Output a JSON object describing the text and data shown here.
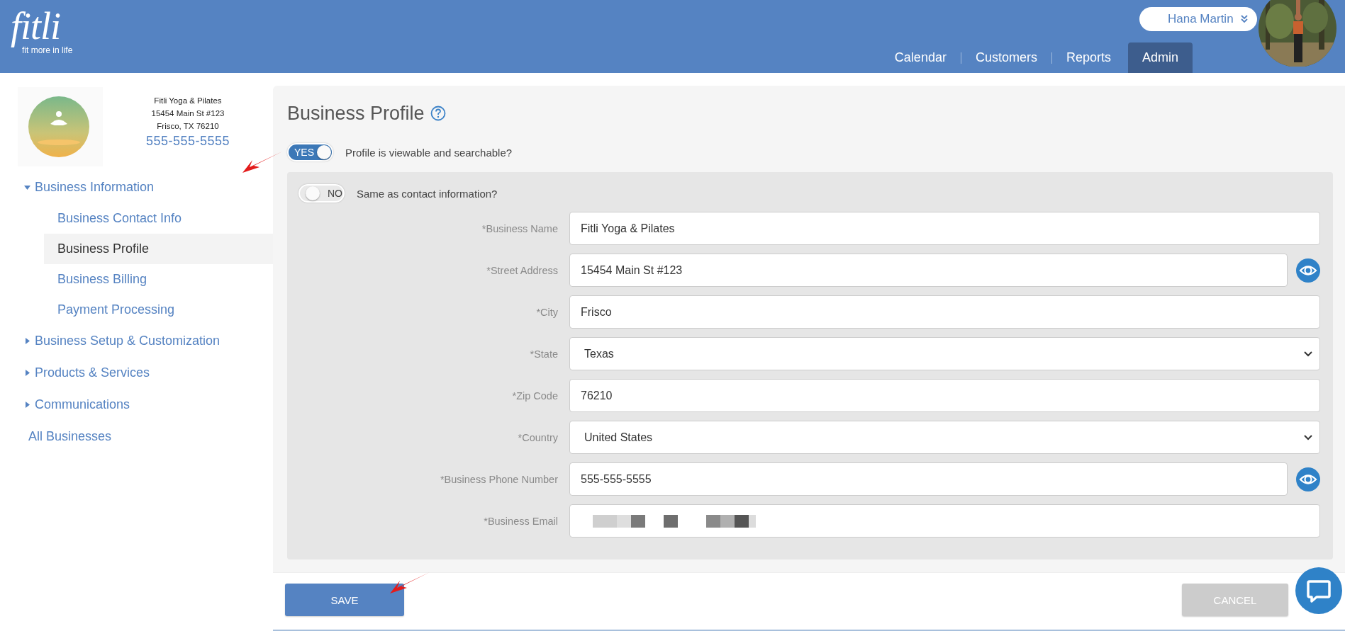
{
  "logo": {
    "wordmark": "fitli",
    "tagline": "fit more in life"
  },
  "user": {
    "name": "Hana Martin"
  },
  "nav": [
    {
      "label": "Calendar",
      "selected": false
    },
    {
      "label": "Customers",
      "selected": false
    },
    {
      "label": "Reports",
      "selected": false
    },
    {
      "label": "Admin",
      "selected": true
    }
  ],
  "business_card": {
    "name": "Fitli Yoga & Pilates",
    "address": "15454 Main St #123",
    "city": "Frisco, TX 76210",
    "phone": "555-555-5555"
  },
  "sidebar": {
    "items": [
      {
        "kind": "group",
        "label": "Business Information",
        "expanded": true,
        "children": [
          {
            "label": "Business Contact Info",
            "selected": false
          },
          {
            "label": "Business Profile",
            "selected": true
          },
          {
            "label": "Business Billing",
            "selected": false
          },
          {
            "label": "Payment Processing",
            "selected": false
          }
        ]
      },
      {
        "kind": "group",
        "label": "Business Setup & Customization",
        "expanded": false
      },
      {
        "kind": "group",
        "label": "Products & Services",
        "expanded": false
      },
      {
        "kind": "group",
        "label": "Communications",
        "expanded": false
      },
      {
        "kind": "link",
        "label": "All Businesses"
      }
    ]
  },
  "page": {
    "title": "Business Profile"
  },
  "visible_toggle": {
    "on": true,
    "text": "YES",
    "label": "Profile is viewable and searchable?"
  },
  "same_toggle": {
    "on": false,
    "text": "NO",
    "label": "Same as contact information?"
  },
  "fields": [
    {
      "kind": "text",
      "label": "*Business Name",
      "value": "Fitli Yoga & Pilates",
      "visibility_button": false
    },
    {
      "kind": "text",
      "label": "*Street Address",
      "value": "15454 Main St #123",
      "visibility_button": true
    },
    {
      "kind": "text",
      "label": "*City",
      "value": "Frisco",
      "visibility_button": false
    },
    {
      "kind": "select",
      "label": "*State",
      "value": "Texas",
      "visibility_button": false
    },
    {
      "kind": "text",
      "label": "*Zip Code",
      "value": "76210",
      "visibility_button": false
    },
    {
      "kind": "select",
      "label": "*Country",
      "value": "United States",
      "visibility_button": false
    },
    {
      "kind": "text",
      "label": "*Business Phone Number",
      "value": "555-555-5555",
      "visibility_button": true
    },
    {
      "kind": "redacted",
      "label": "*Business Email",
      "visibility_button": false
    }
  ],
  "buttons": {
    "save": {
      "label": "SAVE",
      "disabled": false
    },
    "cancel": {
      "label": "CANCEL",
      "disabled": true
    }
  }
}
